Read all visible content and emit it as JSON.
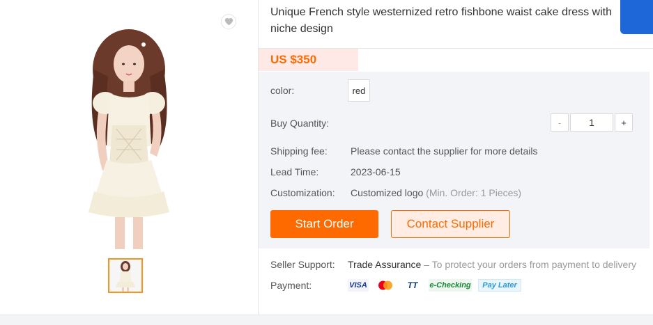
{
  "product": {
    "title": "Unique French style westernized retro fishbone waist cake dress with niche design",
    "price": "US $350",
    "image_alt": "white dress"
  },
  "attributes": {
    "color_label": "color:",
    "color_value": "red",
    "quantity_label": "Buy Quantity:",
    "quantity_value": "1",
    "minus": "-",
    "plus": "+"
  },
  "details": {
    "shipping_label": "Shipping fee:",
    "shipping_value": "Please contact the supplier for more details",
    "lead_label": "Lead Time:",
    "lead_value": "2023-06-15",
    "custom_label": "Customization:",
    "custom_value": "Customized logo",
    "custom_note": "(Min. Order: 1 Pieces)"
  },
  "actions": {
    "start_order": "Start Order",
    "contact_supplier": "Contact Supplier"
  },
  "support": {
    "seller_label": "Seller Support:",
    "trade_assurance": "Trade Assurance",
    "trade_note": "– To protect your orders from payment to delivery",
    "payment_label": "Payment:",
    "payment_methods": [
      "VISA",
      "TT",
      "e-Checking",
      "Pay Later"
    ]
  },
  "colors": {
    "accent": "#ff6a00",
    "blue_tab": "#1d67d8",
    "price_bg": "#ffe9e6",
    "info_bg": "#f3f4f7"
  },
  "icons": [
    "heart-icon",
    "mastercard-icon"
  ]
}
